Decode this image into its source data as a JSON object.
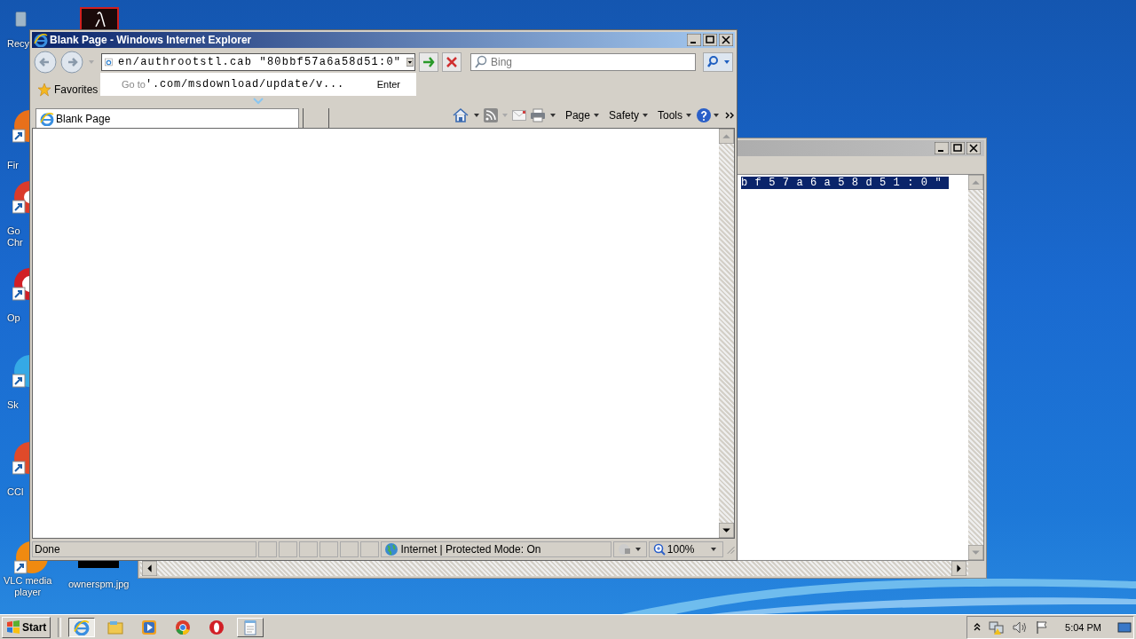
{
  "desktop": {
    "icons": [
      {
        "lines": [
          "Recy"
        ]
      },
      {
        "lines": [
          "Fir"
        ]
      },
      {
        "lines": [
          "Go",
          "Chr"
        ]
      },
      {
        "lines": [
          "Op"
        ]
      },
      {
        "lines": [
          "Sk"
        ]
      },
      {
        "lines": [
          "CCl"
        ]
      },
      {
        "lines": [
          "VLC media",
          "player"
        ]
      }
    ],
    "file_icon": {
      "label": "ownerspm.jpg"
    }
  },
  "background_window": {
    "text": {
      "value": "bf57a6a58d51:0\"",
      "selected": true
    }
  },
  "ie_window": {
    "title": "Blank Page - Windows Internet Explorer",
    "address": {
      "value": "en/authrootstl.cab \"80bbf57a6a58d51:0\""
    },
    "autocomplete": {
      "prefix": "Go to",
      "text": "'.com/msdownload/update/v...",
      "action": "Enter"
    },
    "search": {
      "placeholder": "Bing"
    },
    "favorites": "Favorites",
    "tabs": [
      {
        "label": "Blank Page",
        "selected": true
      }
    ],
    "commands": [
      "Page",
      "Safety",
      "Tools"
    ],
    "status": {
      "text": "Done",
      "zone": "Internet | Protected Mode: On",
      "zoom": "100%"
    }
  },
  "taskbar": {
    "start": "Start",
    "tasks": [
      {
        "selected": true
      },
      {
        "selected": false
      }
    ],
    "time": "5:04 PM"
  }
}
